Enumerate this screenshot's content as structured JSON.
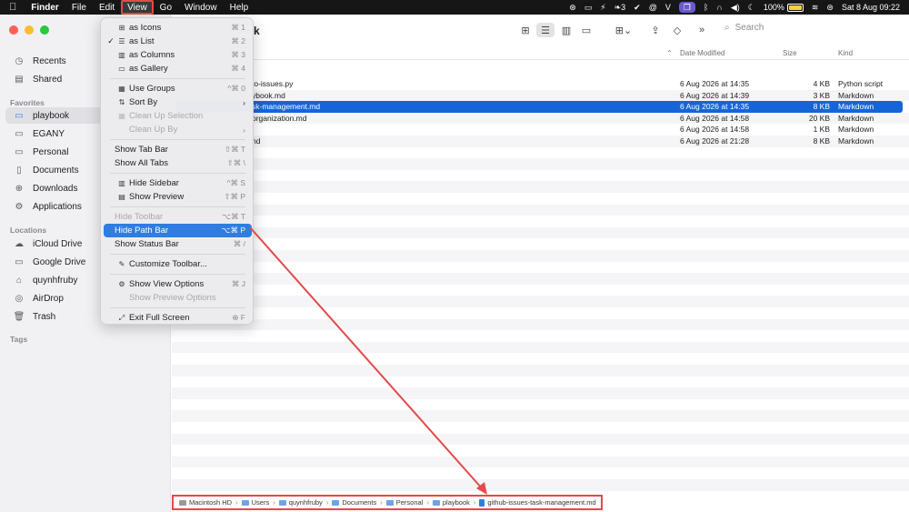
{
  "menubar": {
    "apple_icon": "",
    "app_name": "Finder",
    "items": [
      "File",
      "Edit",
      "View",
      "Go",
      "Window",
      "Help"
    ],
    "battery_percent": "100%",
    "clock": "Sat 8 Aug  09:22",
    "extra_counter": "3"
  },
  "sidebar": {
    "sections": {
      "favorites": "Favorites",
      "locations": "Locations",
      "tags": "Tags"
    },
    "top_items": [
      {
        "label": "Recents",
        "icon": "clock-icon"
      },
      {
        "label": "Shared",
        "icon": "shared-folder-icon"
      }
    ],
    "favorites": [
      {
        "label": "playbook",
        "icon": "folder-icon"
      },
      {
        "label": "EGANY",
        "icon": "folder-icon"
      },
      {
        "label": "Personal",
        "icon": "folder-icon"
      },
      {
        "label": "Documents",
        "icon": "document-icon"
      },
      {
        "label": "Downloads",
        "icon": "download-icon"
      },
      {
        "label": "Applications",
        "icon": "applications-icon"
      }
    ],
    "locations": [
      {
        "label": "iCloud Drive",
        "icon": "cloud-icon"
      },
      {
        "label": "Google Drive",
        "icon": "drive-icon"
      },
      {
        "label": "quynhfruby",
        "icon": "home-icon"
      },
      {
        "label": "AirDrop",
        "icon": "airdrop-icon"
      },
      {
        "label": "Trash",
        "icon": "trash-icon"
      }
    ]
  },
  "toolbar": {
    "title_fragment": "k",
    "search_label": "Search"
  },
  "list": {
    "columns": {
      "date": "Date Modified",
      "size": "Size",
      "kind": "Kind"
    },
    "rows": [
      {
        "name": "to-issues.py",
        "date": "6 Aug 2026 at 14:35",
        "size": "4 KB",
        "kind": "Python script"
      },
      {
        "name": "ybook.md",
        "date": "6 Aug 2026 at 14:39",
        "size": "3 KB",
        "kind": "Markdown"
      },
      {
        "name": "sk-management.md",
        "date": "6 Aug 2026 at 14:35",
        "size": "8 KB",
        "kind": "Markdown"
      },
      {
        "name": "organization.md",
        "date": "6 Aug 2026 at 14:58",
        "size": "20 KB",
        "kind": "Markdown"
      },
      {
        "name": "",
        "date": "6 Aug 2026 at 14:58",
        "size": "1 KB",
        "kind": "Markdown"
      },
      {
        "name": "nd",
        "date": "6 Aug 2026 at 21:28",
        "size": "8 KB",
        "kind": "Markdown"
      }
    ]
  },
  "pathbar": {
    "crumbs": [
      "Macintosh HD",
      "Users",
      "quynhfruby",
      "Documents",
      "Personal",
      "playbook",
      "github-issues-task-management.md"
    ]
  },
  "view_menu": {
    "items": [
      {
        "label": "as Icons",
        "shortcut": "⌘ 1",
        "icon": "icons-view-icon"
      },
      {
        "label": "as List",
        "shortcut": "⌘ 2",
        "icon": "list-view-icon",
        "checked": "✓"
      },
      {
        "label": "as Columns",
        "shortcut": "⌘ 3",
        "icon": "columns-view-icon"
      },
      {
        "label": "as Gallery",
        "shortcut": "⌘ 4",
        "icon": "gallery-view-icon"
      },
      {
        "label": "Use Groups",
        "shortcut": "^⌘ 0",
        "icon": "groups-icon"
      },
      {
        "label": "Sort By",
        "shortcut": "›",
        "icon": "sort-icon"
      },
      {
        "label": "Clean Up Selection",
        "shortcut": "",
        "icon": "cleanup-icon"
      },
      {
        "label": "Clean Up By",
        "shortcut": "›"
      },
      {
        "label": "Show Tab Bar",
        "shortcut": "⇧⌘ T"
      },
      {
        "label": "Show All Tabs",
        "shortcut": "⇧⌘ \\"
      },
      {
        "label": "Hide Sidebar",
        "shortcut": "^⌘ S",
        "icon": "sidebar-icon"
      },
      {
        "label": "Show Preview",
        "shortcut": "⇧⌘ P",
        "icon": "preview-icon"
      },
      {
        "label": "Hide Toolbar",
        "shortcut": "⌥⌘ T"
      },
      {
        "label": "Hide Path Bar",
        "shortcut": "⌥⌘ P"
      },
      {
        "label": "Show Status Bar",
        "shortcut": "⌘ /"
      },
      {
        "label": "Customize Toolbar...",
        "shortcut": "",
        "icon": "customize-icon"
      },
      {
        "label": "Show View Options",
        "shortcut": "⌘ J",
        "icon": "view-options-icon"
      },
      {
        "label": "Show Preview Options",
        "shortcut": ""
      },
      {
        "label": "Exit Full Screen",
        "shortcut": "F",
        "icon": "fullscreen-icon"
      }
    ]
  },
  "colors": {
    "selection_blue": "#1565d8",
    "menu_highlight": "#2f7de0",
    "annotation_red": "#e34a4a"
  }
}
